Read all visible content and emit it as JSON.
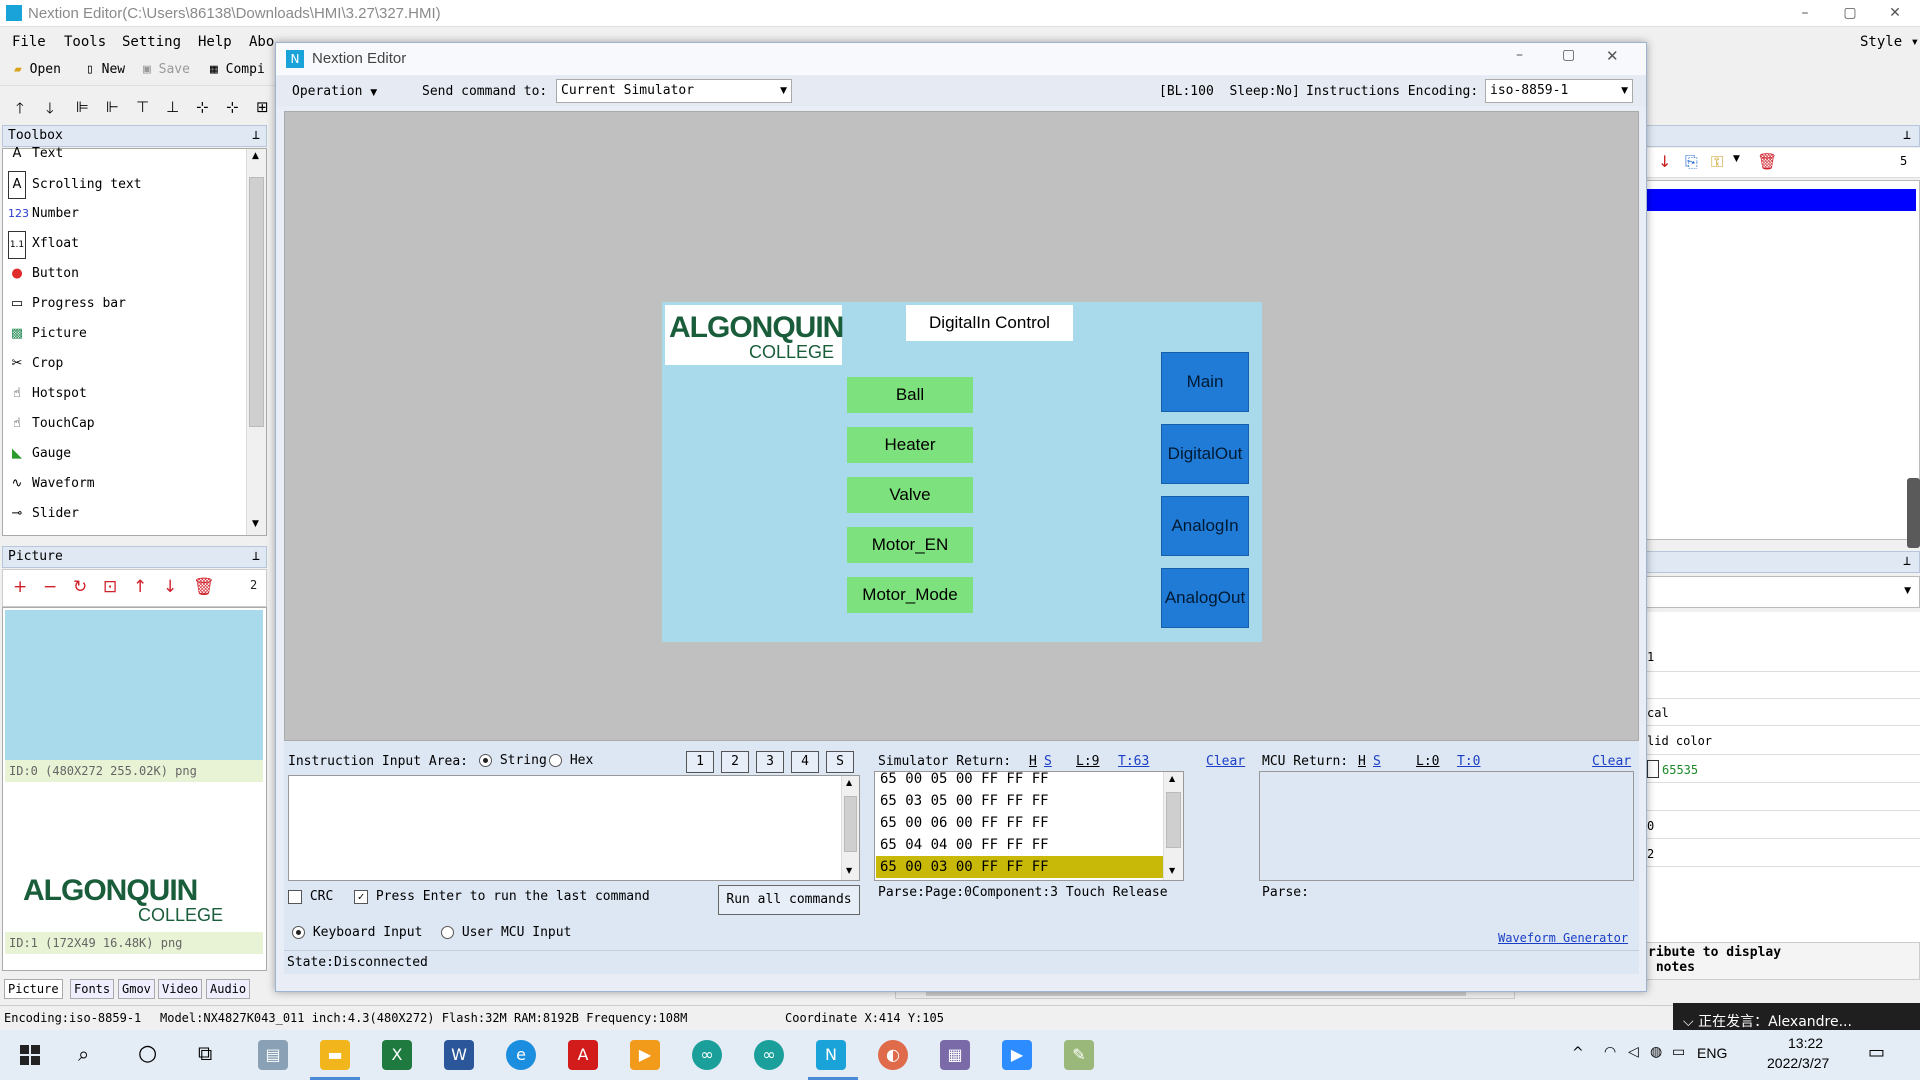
{
  "app": {
    "title": "Nextion Editor(C:\\Users\\86138\\Downloads\\HMI\\3.27\\327.HMI)",
    "menu": [
      "File",
      "Tools",
      "Setting",
      "Help",
      "Abo"
    ],
    "style_label": "Style",
    "toolbar": {
      "open": "Open",
      "new": "New",
      "save": "Save",
      "compile": "Compi"
    }
  },
  "toolbox": {
    "title": "Toolbox",
    "items": [
      {
        "label": "Text",
        "icon": "text-icon"
      },
      {
        "label": "Scrolling text",
        "icon": "scrolling-text-icon"
      },
      {
        "label": "Number",
        "icon": "number-icon"
      },
      {
        "label": "Xfloat",
        "icon": "xfloat-icon"
      },
      {
        "label": "Button",
        "icon": "button-icon"
      },
      {
        "label": "Progress bar",
        "icon": "progress-bar-icon"
      },
      {
        "label": "Picture",
        "icon": "picture-icon"
      },
      {
        "label": "Crop",
        "icon": "crop-icon"
      },
      {
        "label": "Hotspot",
        "icon": "hotspot-icon"
      },
      {
        "label": "TouchCap",
        "icon": "touchcap-icon"
      },
      {
        "label": "Gauge",
        "icon": "gauge-icon"
      },
      {
        "label": "Waveform",
        "icon": "waveform-icon"
      },
      {
        "label": "Slider",
        "icon": "slider-icon"
      }
    ]
  },
  "picture_panel": {
    "title": "Picture",
    "count": "2",
    "images": [
      {
        "info": "ID:0  (480X272 255.02K) png"
      },
      {
        "info": "ID:1  (172X49 16.48K) png"
      }
    ],
    "logo_text_main": "ALGONQUIN",
    "logo_text_sub": "COLLEGE",
    "tabs": [
      "Picture",
      "Fonts",
      "Gmov",
      "Video",
      "Audio"
    ]
  },
  "right_panel": {
    "count": "5",
    "frag1": "1",
    "frag2": "cal",
    "frag3": "lid color",
    "color_value": "65535",
    "frag4": "0",
    "frag5": "2",
    "note_line1": "ribute to display",
    "note_line2": " notes"
  },
  "modal": {
    "title": "Nextion Editor",
    "operation_label": "Operation",
    "send_label": "Send command to:",
    "send_target": "Current Simulator",
    "status_info": "[BL:100  Sleep:No]",
    "encoding_label": "Instructions Encoding:",
    "encoding_value": "iso-8859-1"
  },
  "hmi": {
    "title_label": "DigitalIn Control",
    "logo_main": "ALGONQUIN",
    "logo_sub": "COLLEGE",
    "left_buttons": [
      "Ball",
      "Heater",
      "Valve",
      "Motor_EN",
      "Motor_Mode"
    ],
    "right_buttons": [
      "Main",
      "DigitalOut",
      "AnalogIn",
      "AnalogOut"
    ],
    "colors": {
      "background": "#a8daec",
      "green": "#7de27d",
      "blue": "#1f7bd6"
    }
  },
  "instruction": {
    "label": "Instruction Input Area:",
    "string_label": "String",
    "hex_label": "Hex",
    "slots": [
      "1",
      "2",
      "3",
      "4",
      "S"
    ],
    "crc_label": "CRC",
    "enter_label": "Press Enter to run the last command",
    "run_all": "Run all commands",
    "keyboard_label": "Keyboard Input",
    "mcu_input_label": "User MCU Input",
    "state": "State:Disconnected"
  },
  "simulator_return": {
    "label": "Simulator Return:",
    "h": "H",
    "s": "S",
    "l": "L:9",
    "t": "T:63",
    "clear": "Clear",
    "rows": [
      "65 00 05 00 FF FF FF",
      "65 03 05 00 FF FF FF",
      "65 00 06 00 FF FF FF",
      "65 04 04 00 FF FF FF",
      "65 00 03 00 FF FF FF"
    ],
    "selected_index": 4,
    "parse": "Parse:Page:0Component:3 Touch Release"
  },
  "mcu_return": {
    "label": "MCU Return:",
    "h": "H",
    "s": "S",
    "l": "L:0",
    "t": "T:0",
    "clear": "Clear",
    "parse": "Parse:",
    "waveform_link": "Waveform Generator"
  },
  "statusbar": {
    "encoding": "Encoding:iso-8859-1",
    "model": "Model:NX4827K043_011  inch:4.3(480X272) Flash:32M RAM:8192B Frequency:108M",
    "coordinate": "Coordinate X:414  Y:105"
  },
  "notification": {
    "text": "正在发言：Alexandre..."
  },
  "taskbar": {
    "time": "13:22",
    "date": "2022/3/27",
    "lang": "ENG"
  }
}
